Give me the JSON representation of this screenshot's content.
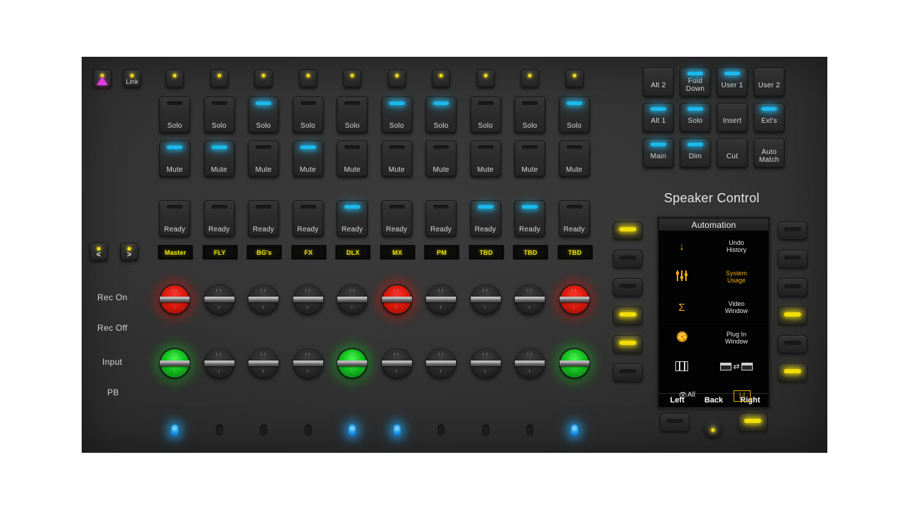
{
  "device": {
    "speaker_control_title": "Speaker Control"
  },
  "top_left": {
    "triangle_button": {
      "name": "triangle",
      "icon": "triangle-icon",
      "led": "on"
    },
    "link_button": {
      "label": "Link",
      "led": "on"
    }
  },
  "nav": {
    "prev": {
      "label": "<",
      "led": "on"
    },
    "next": {
      "label": ">",
      "led": "on"
    }
  },
  "side_labels": [
    "Rec On",
    "Rec Off",
    "Input",
    "PB"
  ],
  "channels": [
    {
      "name": "Master",
      "select_led": "on",
      "solo": "off",
      "mute": "on",
      "ready": "off",
      "rec": "on",
      "input": "on",
      "bottom_led": "on"
    },
    {
      "name": "FLY",
      "select_led": "on",
      "solo": "off",
      "mute": "on",
      "ready": "off",
      "rec": "off",
      "input": "off",
      "bottom_led": "off"
    },
    {
      "name": "BG's",
      "select_led": "on",
      "solo": "on",
      "mute": "off",
      "ready": "off",
      "rec": "off",
      "input": "off",
      "bottom_led": "off"
    },
    {
      "name": "FX",
      "select_led": "on",
      "solo": "off",
      "mute": "on",
      "ready": "off",
      "rec": "off",
      "input": "off",
      "bottom_led": "off"
    },
    {
      "name": "DLX",
      "select_led": "on",
      "solo": "off",
      "mute": "off",
      "ready": "on",
      "rec": "off",
      "input": "on",
      "bottom_led": "on"
    },
    {
      "name": "MX",
      "select_led": "on",
      "solo": "on",
      "mute": "off",
      "ready": "off",
      "rec": "on",
      "input": "off",
      "bottom_led": "on"
    },
    {
      "name": "PM",
      "select_led": "on",
      "solo": "on",
      "mute": "off",
      "ready": "off",
      "rec": "off",
      "input": "off",
      "bottom_led": "off"
    },
    {
      "name": "TBD",
      "select_led": "on",
      "solo": "off",
      "mute": "off",
      "ready": "on",
      "rec": "off",
      "input": "off",
      "bottom_led": "off"
    },
    {
      "name": "TBD",
      "select_led": "on",
      "solo": "off",
      "mute": "off",
      "ready": "on",
      "rec": "off",
      "input": "off",
      "bottom_led": "off"
    },
    {
      "name": "TBD",
      "select_led": "on",
      "solo": "on",
      "mute": "off",
      "ready": "off",
      "rec": "on",
      "input": "on",
      "bottom_led": "on"
    }
  ],
  "channel_button_labels": {
    "solo": "Solo",
    "mute": "Mute",
    "ready": "Ready"
  },
  "speaker_control": {
    "buttons": [
      {
        "label": "Alt 2",
        "led": "off"
      },
      {
        "label": "Fold\nDown",
        "led": "on"
      },
      {
        "label": "User 1",
        "led": "on"
      },
      {
        "label": "User 2",
        "led": "off"
      },
      {
        "label": "Alt 1",
        "led": "on"
      },
      {
        "label": "Solo",
        "led": "on"
      },
      {
        "label": "Insert",
        "led": "off"
      },
      {
        "label": "Ext's",
        "led": "on"
      },
      {
        "label": "Main",
        "led": "on"
      },
      {
        "label": "Dim",
        "led": "on"
      },
      {
        "label": "Cut",
        "led": "off"
      },
      {
        "label": "Auto\nMatch",
        "led": "off"
      }
    ]
  },
  "lcd": {
    "title": "Automation",
    "rows": [
      {
        "icon": "down-arrow-icon",
        "icon_glyph": "↓",
        "label": "Undo\nHistory",
        "highlight": false
      },
      {
        "icon": "faders-icon",
        "icon_glyph": "faders",
        "label": "System\nUsage",
        "highlight": true
      },
      {
        "icon": "sigma-icon",
        "icon_glyph": "Σ",
        "label": "Video\nWindow",
        "highlight": false
      },
      {
        "icon": "palette-icon",
        "icon_glyph": "palette",
        "label": "Plug In\nWindow",
        "highlight": false
      },
      {
        "icon": "piano-keys-icon",
        "icon_glyph": "keys",
        "label": "swap",
        "highlight": false
      },
      {
        "icon": "eye-icon",
        "icon_glyph": "eye",
        "label": "All",
        "highlight": false
      }
    ],
    "footer": [
      "Left",
      "Back",
      "Right"
    ]
  },
  "soft_keys": {
    "left": [
      "on",
      "off",
      "off",
      "on",
      "on",
      "off"
    ],
    "right": [
      "off",
      "off",
      "off",
      "on",
      "off",
      "on"
    ],
    "bottom": {
      "left_key": "off",
      "knob_led": "on",
      "right_key": "on"
    }
  },
  "colors": {
    "led_blue": "#19baf0",
    "led_yellow": "#f3e005",
    "led_red": "#e4190c",
    "led_green": "#0fc21a",
    "scribble_text": "#ece500",
    "lcd_amber": "#f0a90a",
    "panel": "#333333"
  }
}
